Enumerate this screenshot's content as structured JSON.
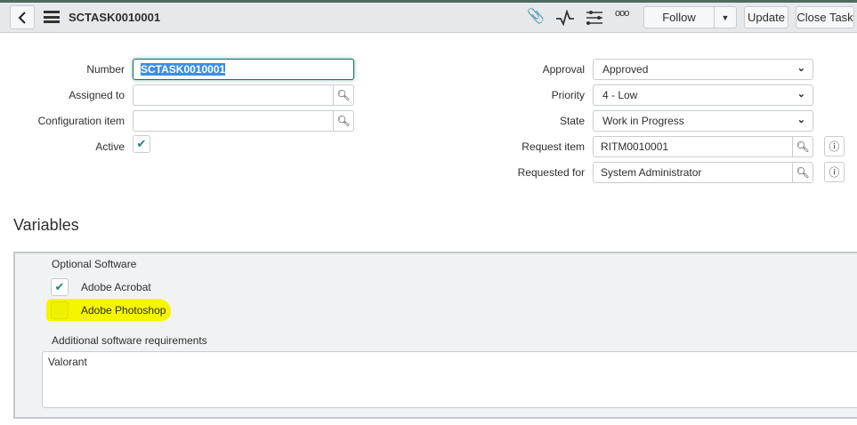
{
  "header": {
    "title": "SCTASK0010001",
    "follow": "Follow",
    "update": "Update",
    "close_task": "Close Task"
  },
  "fields_left": {
    "number_label": "Number",
    "number_value": "SCTASK0010001",
    "assigned_label": "Assigned to",
    "assigned_value": "",
    "ci_label": "Configuration item",
    "ci_value": "",
    "active_label": "Active",
    "active_checked": true
  },
  "fields_right": {
    "approval_label": "Approval",
    "approval_value": "Approved",
    "priority_label": "Priority",
    "priority_value": "4 - Low",
    "state_label": "State",
    "state_value": "Work in Progress",
    "request_item_label": "Request item",
    "request_item_value": "RITM0010001",
    "requested_for_label": "Requested for",
    "requested_for_value": "System Administrator"
  },
  "variables": {
    "heading": "Variables",
    "optional_label": "Optional Software",
    "options": [
      {
        "label": "Adobe Acrobat",
        "checked": true
      },
      {
        "label": "Adobe Photoshop",
        "checked": false
      }
    ],
    "additional_label": "Additional software requirements",
    "additional_value": "Valorant"
  },
  "colors": {
    "accent": "#1f8476",
    "highlight": "#f5f500",
    "header_bg": "#e6e9eb"
  }
}
